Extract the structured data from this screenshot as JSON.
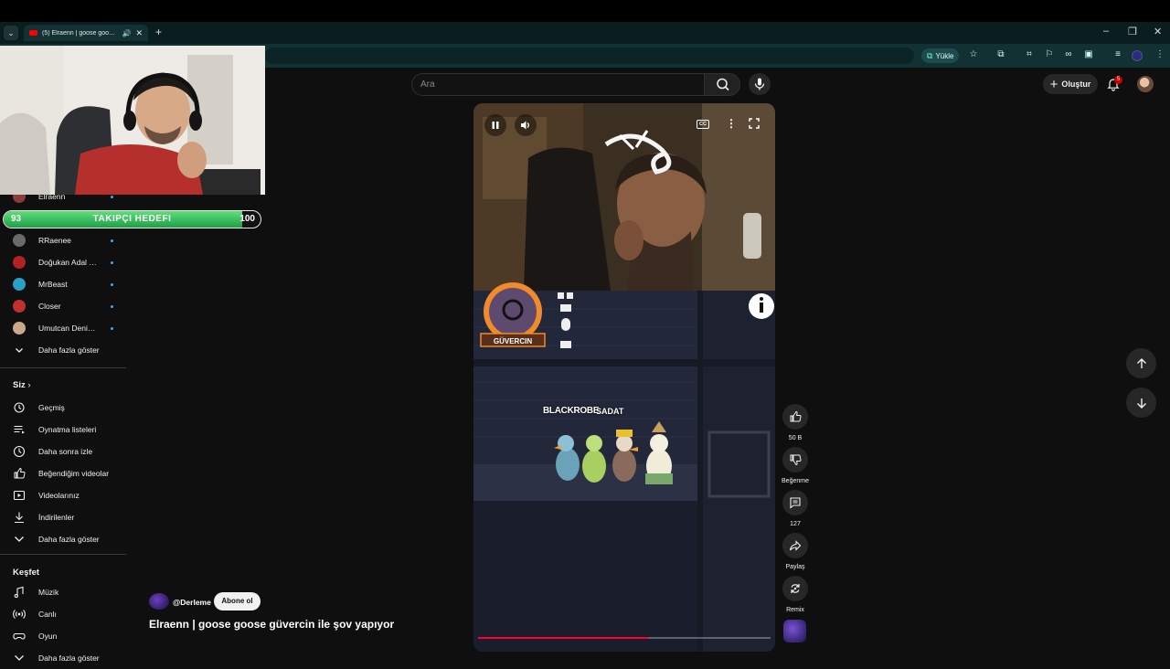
{
  "browser": {
    "tab_title": "(5) Elraenn | goose goose g",
    "upload_label": "Yükle",
    "window_controls": [
      "–",
      "❐",
      "✕"
    ]
  },
  "header": {
    "search_placeholder": "Ara",
    "create_label": "Oluştur",
    "notification_count": "5"
  },
  "sidebar": {
    "subscriptions": [
      {
        "name": "Elraenn",
        "color": "#8a3b3b"
      },
      {
        "name": "RRaenee",
        "color": "#6a6a6a"
      },
      {
        "name": "Doğukan Adal [T...",
        "color": "#b32222"
      },
      {
        "name": "MrBeast",
        "color": "#2aa0c8"
      },
      {
        "name": "Closer",
        "color": "#c03030"
      },
      {
        "name": "Umutcan Deniz İl...",
        "color": "#c9a98a"
      }
    ],
    "show_more": "Daha fazla göster",
    "you_title": "Siz",
    "you_items": [
      {
        "label": "Geçmiş",
        "icon": "history-icon"
      },
      {
        "label": "Oynatma listeleri",
        "icon": "playlist-icon"
      },
      {
        "label": "Daha sonra izle",
        "icon": "clock-icon"
      },
      {
        "label": "Beğendiğim videolar",
        "icon": "thumb-up-icon"
      },
      {
        "label": "Videolarınız",
        "icon": "video-icon"
      },
      {
        "label": "İndirilenler",
        "icon": "download-icon"
      },
      {
        "label": "Daha fazla göster",
        "icon": "chevron-down-icon"
      }
    ],
    "explore_title": "Keşfet",
    "explore_items": [
      {
        "label": "Müzik",
        "icon": "music-icon"
      },
      {
        "label": "Canlı",
        "icon": "live-icon"
      },
      {
        "label": "Oyun",
        "icon": "gamepad-icon"
      },
      {
        "label": "Daha fazla göster",
        "icon": "chevron-down-icon"
      }
    ]
  },
  "goal": {
    "label": "TAKIPÇI HEDEFI",
    "current": "93",
    "target": "100",
    "fill_fraction": 0.93
  },
  "player": {
    "game_player_label": "GÜVERCIN",
    "nametag": "BLACKROBE",
    "nametag2": "SADAT",
    "progress_fraction": 0.58
  },
  "video": {
    "channel": "@Derleme",
    "subscribe_label": "Abone ol",
    "title": "Elraenn | goose goose güvercin ile şov yapıyor"
  },
  "actions": {
    "likes": "50 B",
    "dislike_label": "Beğenme",
    "comments": "127",
    "share_label": "Paylaş",
    "remix_label": "Remix"
  }
}
